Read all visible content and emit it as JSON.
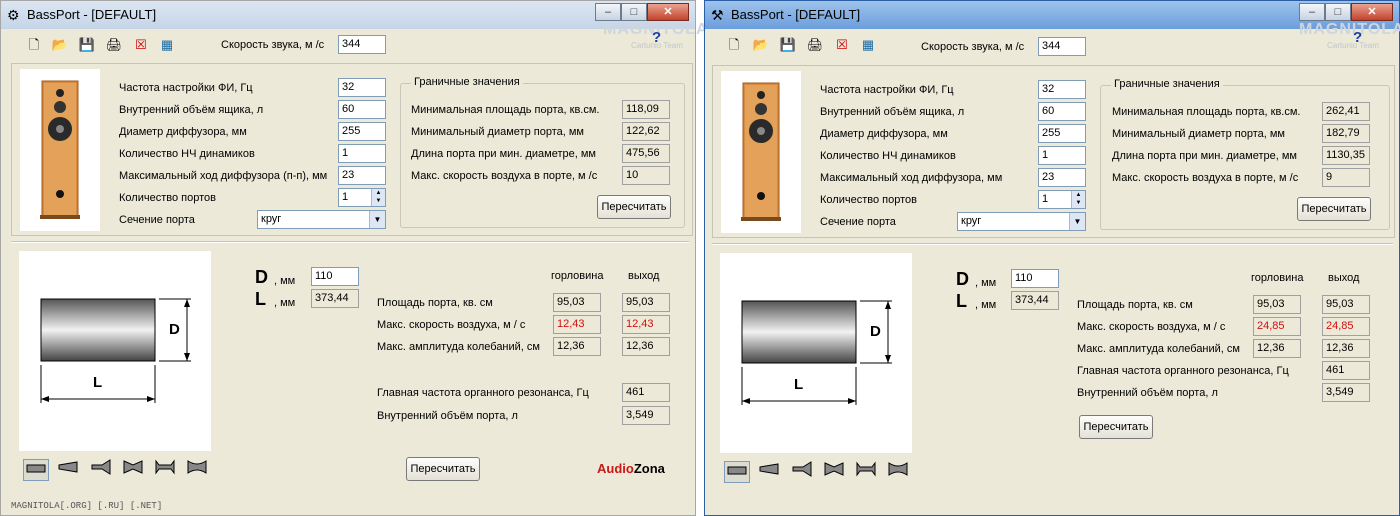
{
  "windows": [
    {
      "title": "BassPort - [DEFAULT]",
      "watermark": "MAGNITOLA",
      "watermark_team": "Cartunio Team",
      "sound_speed_label": "Скорость звука, м /с",
      "sound_speed": "344",
      "params": [
        {
          "label": "Частота настройки ФИ, Гц",
          "value": "32"
        },
        {
          "label": "Внутренний объём ящика, л",
          "value": "60"
        },
        {
          "label": "Диаметр диффузора, мм",
          "value": "255"
        },
        {
          "label": "Количество НЧ динамиков",
          "value": "1"
        },
        {
          "label": "Максимальный ход диффузора (п-п), мм",
          "value": "23"
        }
      ],
      "ports_label": "Количество портов",
      "ports_value": "1",
      "section_label": "Сечение порта",
      "section_value": "круг",
      "limits_title": "Граничные значения",
      "limits": [
        {
          "label": "Минимальная площадь порта, кв.см.",
          "value": "118,09"
        },
        {
          "label": "Минимальный диаметр порта, мм",
          "value": "122,62"
        },
        {
          "label": "Длина порта при мин. диаметре, мм",
          "value": "475,56"
        },
        {
          "label": "Макс. скорость воздуха в порте, м /с",
          "value": "10"
        }
      ],
      "recalc": "Пересчитать",
      "d_letter": "D",
      "l_letter": "L",
      "unit_mm": ", мм",
      "d_value": "110",
      "l_value": "373,44",
      "col_throat": "горловина",
      "col_exit": "выход",
      "results": [
        {
          "label": "Площадь порта, кв. см",
          "throat": "95,03",
          "exit": "95,03",
          "warn": false
        },
        {
          "label": "Макс. скорость воздуха, м / с",
          "throat": "12,43",
          "exit": "12,43",
          "warn": true
        },
        {
          "label": "Макс. амплитуда колебаний, см",
          "throat": "12,36",
          "exit": "12,36",
          "warn": false
        }
      ],
      "organ_label": "Главная частота органного резонанса, Гц",
      "organ_value": "461",
      "port_vol_label": "Внутренний объём порта, л",
      "port_vol_value": "3,549",
      "brand_a": "Audio",
      "brand_b": "Zona",
      "status": "MAGNITOLA[.ORG] [.RU] [.NET]"
    },
    {
      "title": "BassPort - [DEFAULT]",
      "watermark": "MAGNITOLA",
      "watermark_team": "Cartunio Team",
      "sound_speed_label": "Скорость звука, м /с",
      "sound_speed": "344",
      "params": [
        {
          "label": "Частота настройки ФИ, Гц",
          "value": "32"
        },
        {
          "label": "Внутренний объём ящика, л",
          "value": "60"
        },
        {
          "label": "Диаметр диффузора, мм",
          "value": "255"
        },
        {
          "label": "Количество НЧ динамиков",
          "value": "1"
        },
        {
          "label": "Максимальный ход диффузора, мм",
          "value": "23"
        }
      ],
      "ports_label": "Количество портов",
      "ports_value": "1",
      "section_label": "Сечение порта",
      "section_value": "круг",
      "limits_title": "Граничные значения",
      "limits": [
        {
          "label": "Минимальная площадь порта, кв.см.",
          "value": "262,41"
        },
        {
          "label": "Минимальный диаметр порта, мм",
          "value": "182,79"
        },
        {
          "label": "Длина порта при мин. диаметре, мм",
          "value": "1130,35"
        },
        {
          "label": "Макс. скорость воздуха в порте, м /с",
          "value": "9"
        }
      ],
      "recalc": "Пересчитать",
      "d_letter": "D",
      "l_letter": "L",
      "unit_mm": ", мм",
      "d_value": "110",
      "l_value": "373,44",
      "col_throat": "горловина",
      "col_exit": "выход",
      "results": [
        {
          "label": "Площадь порта, кв. см",
          "throat": "95,03",
          "exit": "95,03",
          "warn": false
        },
        {
          "label": "Макс. скорость воздуха, м / с",
          "throat": "24,85",
          "exit": "24,85",
          "warn": true
        },
        {
          "label": "Макс. амплитуда колебаний, см",
          "throat": "12,36",
          "exit": "12,36",
          "warn": false
        }
      ],
      "organ_label": "Главная частота органного резонанса, Гц",
      "organ_value": "461",
      "port_vol_label": "Внутренний объём порта, л",
      "port_vol_value": "3,549"
    }
  ],
  "icons": {
    "toolbar": [
      "new-file-icon",
      "open-folder-icon",
      "save-icon",
      "print-icon",
      "delete-icon",
      "calculator-icon"
    ],
    "port_shapes": [
      "straight-port-icon",
      "conical-port-icon",
      "horn-port-icon",
      "double-cone-port-icon",
      "flared-port-icon",
      "double-flared-port-icon"
    ],
    "help": "help-icon"
  },
  "colors": {
    "warning_value": "#d01010",
    "brand_red": "#c81818"
  }
}
